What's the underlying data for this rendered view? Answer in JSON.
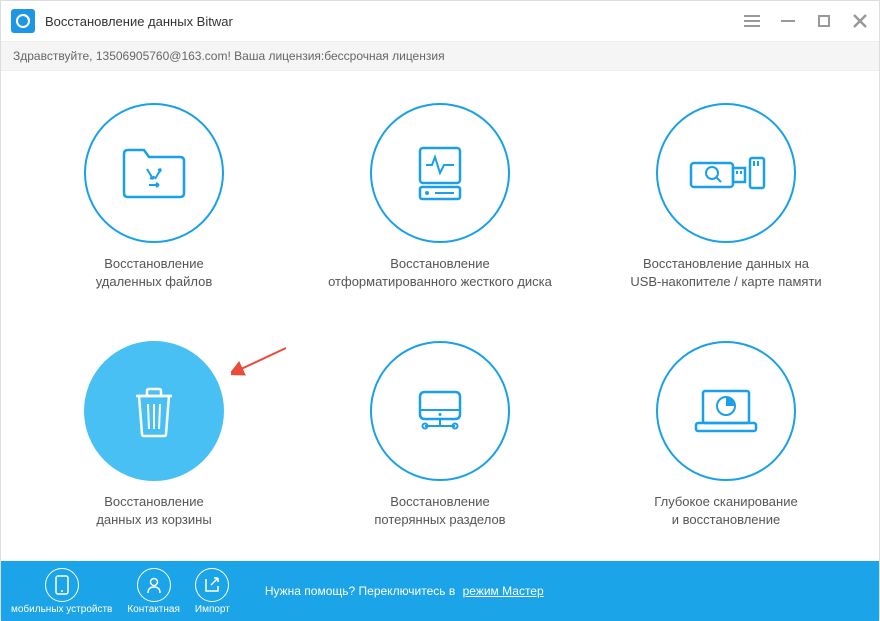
{
  "titlebar": {
    "title": "Восстановление данных Bitwar"
  },
  "greeting": "Здравствуйте, 13506905760@163.com! Ваша лицензия:бессрочная лицензия",
  "options": [
    {
      "label": "Восстановление\nудаленных файлов"
    },
    {
      "label": "Восстановление\nотформатированного жесткого диска"
    },
    {
      "label": "Восстановление данных на\nUSB-накопителе / карте памяти"
    },
    {
      "label": "Восстановление\nданных из корзины",
      "active": true
    },
    {
      "label": "Восстановление\nпотерянных разделов"
    },
    {
      "label": "Глубокое сканирование\nи восстановление"
    }
  ],
  "footer": {
    "mobile": "мобильных устройств",
    "contact": "Контактная",
    "import": "Импорт",
    "help_text": "Нужна помощь? Переключитесь в",
    "help_link": "режим Мастер"
  }
}
